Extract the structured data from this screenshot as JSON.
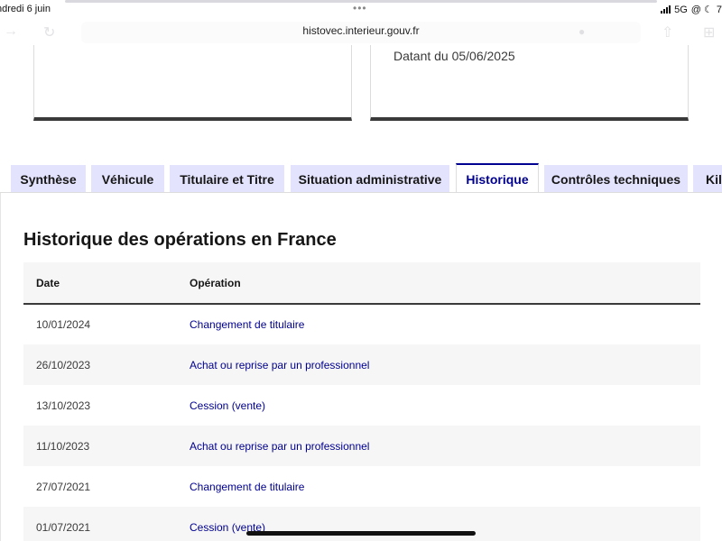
{
  "status_bar": {
    "date": "ndredi 6 juin",
    "network": "5G",
    "extra_icons": "@ ☾",
    "battery_partial": "7"
  },
  "browser": {
    "url": "histovec.interieur.gouv.fr"
  },
  "top_card": {
    "datant": "Datant du 05/06/2025"
  },
  "tabs": [
    {
      "label": "Synthèse",
      "active": false
    },
    {
      "label": "Véhicule",
      "active": false
    },
    {
      "label": "Titulaire et Titre",
      "active": false
    },
    {
      "label": "Situation administrative",
      "active": false
    },
    {
      "label": "Historique",
      "active": true
    },
    {
      "label": "Contrôles techniques",
      "active": false
    },
    {
      "label": "Kilo",
      "active": false
    }
  ],
  "history": {
    "title": "Historique des opérations en France",
    "columns": {
      "date": "Date",
      "operation": "Opération"
    },
    "rows": [
      {
        "date": "10/01/2024",
        "operation": "Changement de titulaire"
      },
      {
        "date": "26/10/2023",
        "operation": "Achat ou reprise par un professionnel"
      },
      {
        "date": "13/10/2023",
        "operation": "Cession (vente)"
      },
      {
        "date": "11/10/2023",
        "operation": "Achat ou reprise par un professionnel"
      },
      {
        "date": "27/07/2021",
        "operation": "Changement de titulaire"
      },
      {
        "date": "01/07/2021",
        "operation": "Cession (vente)"
      }
    ]
  },
  "colors": {
    "accent": "#000091",
    "tab_inactive_bg": "#e3e3fd",
    "row_alt_bg": "#f6f6f6"
  }
}
